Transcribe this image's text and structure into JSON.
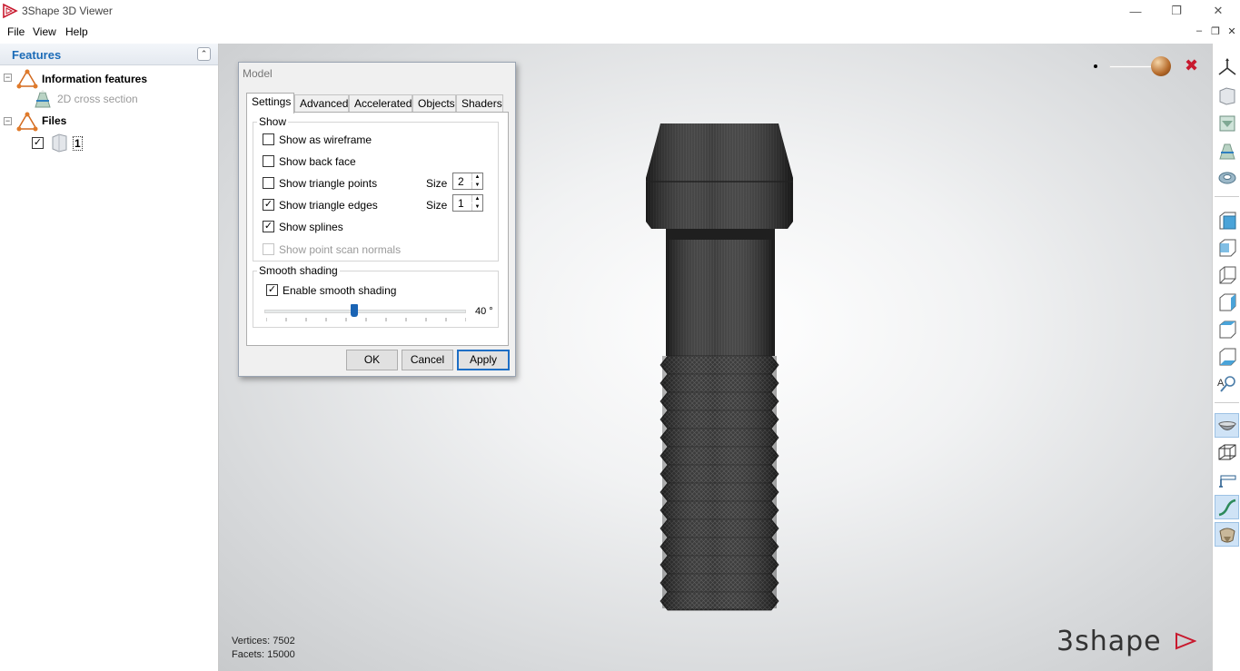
{
  "window": {
    "title": "3Shape 3D Viewer",
    "minimize": "—",
    "restore": "❐",
    "close": "✕",
    "mdi_minimize": "–",
    "mdi_restore": "❐",
    "mdi_close": "✕"
  },
  "menu": {
    "file": "File",
    "view": "View",
    "help": "Help"
  },
  "features_panel": {
    "title": "Features",
    "collapse_icon": "chevrons-up-icon",
    "groups": [
      {
        "label": "Information features",
        "expander": "−",
        "children": [
          {
            "label": "2D cross section"
          }
        ]
      },
      {
        "label": "Files",
        "expander": "−",
        "children": [
          {
            "label": "1",
            "checked": true
          }
        ]
      }
    ]
  },
  "viewport": {
    "vertices_text": "Vertices: 7502",
    "facets_text": "Facets: 15000",
    "logo_text": "3shape",
    "close_symbol": "✖",
    "model_color": "#3a3a3a",
    "brand_color": "#c8192e"
  },
  "dialog": {
    "title": "Model",
    "tabs": [
      "Settings",
      "Advanced",
      "Accelerated",
      "Objects",
      "Shaders"
    ],
    "active_tab": "Settings",
    "show_group": {
      "label": "Show",
      "options": [
        {
          "label": "Show as wireframe",
          "checked": false,
          "enabled": true
        },
        {
          "label": "Show back face",
          "checked": false,
          "enabled": true
        },
        {
          "label": "Show triangle points",
          "checked": false,
          "enabled": true,
          "size_label": "Size",
          "size": "2"
        },
        {
          "label": "Show triangle edges",
          "checked": true,
          "enabled": true,
          "size_label": "Size",
          "size": "1"
        },
        {
          "label": "Show splines",
          "checked": true,
          "enabled": true
        },
        {
          "label": "Show point scan normals",
          "checked": false,
          "enabled": false
        }
      ]
    },
    "smooth_group": {
      "label": "Smooth shading",
      "enable_label": "Enable smooth shading",
      "enabled": true,
      "angle": 40,
      "angle_max": 90,
      "angle_text": "40 °"
    },
    "buttons": {
      "ok": "OK",
      "cancel": "Cancel",
      "apply": "Apply"
    },
    "check_mark": "✓"
  },
  "toolbar_icons": [
    "axes-icon",
    "cube-front-icon",
    "section-icon",
    "cross-section-icon",
    "ring-icon",
    "view-front-icon",
    "view-back-icon",
    "view-left-icon",
    "view-right-icon",
    "view-top-icon",
    "view-bottom-icon",
    "zoom-text-icon",
    "bowl-icon",
    "cube-outline-icon",
    "ruler-icon",
    "spline-icon",
    "shaded-model-icon"
  ]
}
